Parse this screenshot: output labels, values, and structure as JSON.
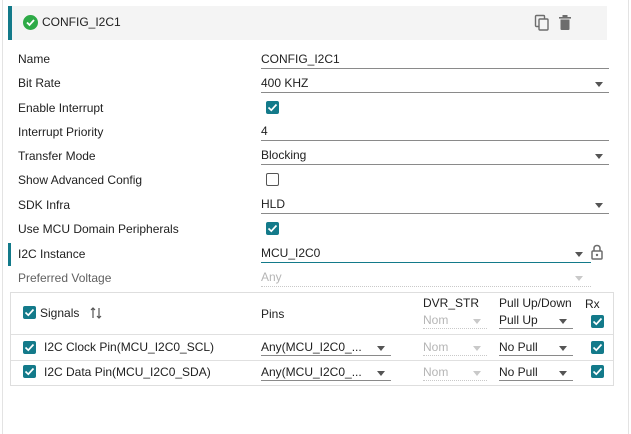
{
  "header": {
    "title": "CONFIG_I2C1",
    "icons": [
      "copy-icon",
      "delete-icon"
    ]
  },
  "fields": {
    "name": {
      "label": "Name",
      "value": "CONFIG_I2C1"
    },
    "bit_rate": {
      "label": "Bit Rate",
      "value": "400 KHZ"
    },
    "enable_interrupt": {
      "label": "Enable Interrupt",
      "checked": true
    },
    "interrupt_priority": {
      "label": "Interrupt Priority",
      "value": "4"
    },
    "transfer_mode": {
      "label": "Transfer Mode",
      "value": "Blocking"
    },
    "show_advanced": {
      "label": "Show Advanced Config",
      "checked": false
    },
    "sdk_infra": {
      "label": "SDK Infra",
      "value": "HLD"
    },
    "use_mcu_domain": {
      "label": "Use MCU Domain Peripherals",
      "checked": true
    },
    "i2c_instance": {
      "label": "I2C Instance",
      "value": "MCU_I2C0"
    },
    "preferred_voltage": {
      "label": "Preferred Voltage",
      "value": "Any"
    }
  },
  "signals_table": {
    "headers": {
      "signals": "Signals",
      "pins": "Pins",
      "dvr_str": "DVR_STR",
      "pull": "Pull Up/Down",
      "rx": "Rx"
    },
    "header_defaults": {
      "dvr_str": "Nom",
      "pull": "Pull Up"
    },
    "rows": [
      {
        "name": "I2C Clock Pin(MCU_I2C0_SCL)",
        "pin": "Any(MCU_I2C0_...",
        "dvr_str": "Nom",
        "pull": "No Pull",
        "rx": true,
        "checked": true
      },
      {
        "name": "I2C Data Pin(MCU_I2C0_SDA)",
        "pin": "Any(MCU_I2C0_...",
        "dvr_str": "Nom",
        "pull": "No Pull",
        "rx": true,
        "checked": true
      }
    ]
  },
  "colors": {
    "accent": "#137a8a",
    "success": "#2eaa47"
  }
}
